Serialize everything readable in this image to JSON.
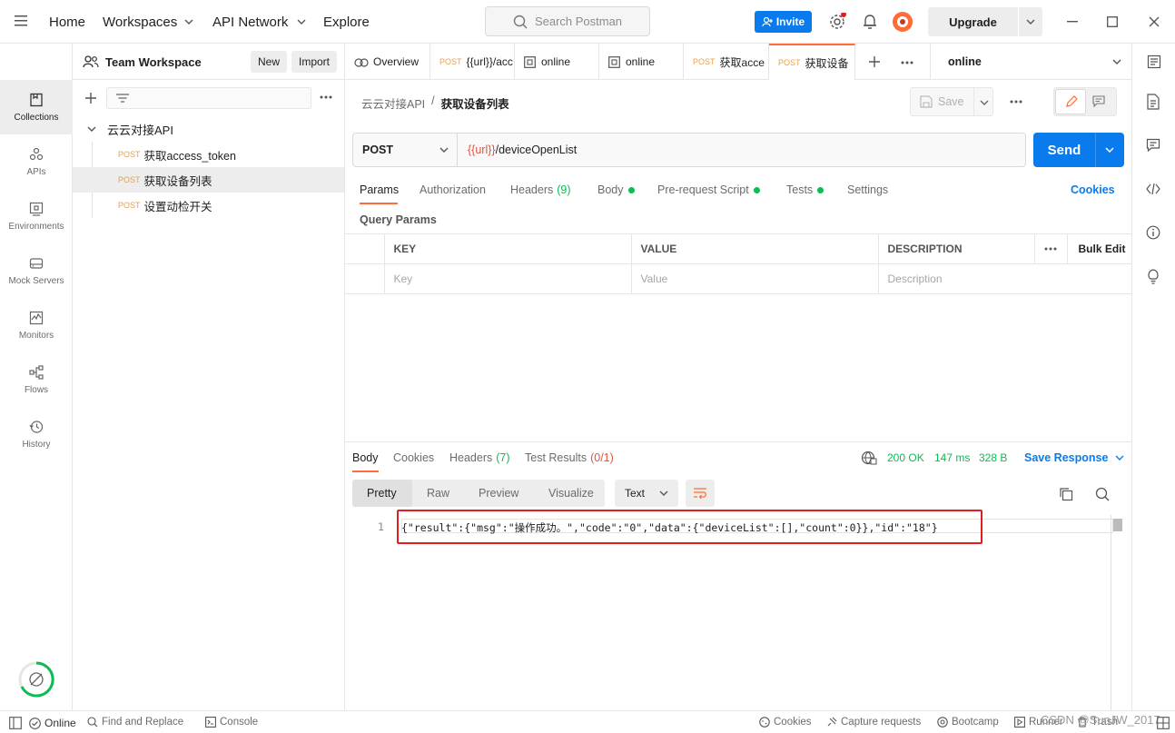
{
  "topbar": {
    "nav": [
      "Home",
      "Workspaces",
      "API Network",
      "Explore"
    ],
    "search_placeholder": "Search Postman",
    "invite_label": "Invite",
    "upgrade_label": "Upgrade"
  },
  "leftbar": {
    "items": [
      {
        "label": "Collections",
        "icon": "collections-icon"
      },
      {
        "label": "APIs",
        "icon": "apis-icon"
      },
      {
        "label": "Environments",
        "icon": "environments-icon"
      },
      {
        "label": "Mock Servers",
        "icon": "mock-servers-icon"
      },
      {
        "label": "Monitors",
        "icon": "monitors-icon"
      },
      {
        "label": "Flows",
        "icon": "flows-icon"
      },
      {
        "label": "History",
        "icon": "history-icon"
      }
    ]
  },
  "sidebar": {
    "workspace_name": "Team Workspace",
    "new_label": "New",
    "import_label": "Import",
    "collection_name": "云云对接API",
    "requests": [
      {
        "method": "POST",
        "name": "获取access_token"
      },
      {
        "method": "POST",
        "name": "获取设备列表"
      },
      {
        "method": "POST",
        "name": "设置动检开关"
      }
    ]
  },
  "tabs": [
    {
      "method": "",
      "label": "Overview"
    },
    {
      "method": "POST",
      "label": "{{url}}/acc"
    },
    {
      "method": "",
      "label": "online"
    },
    {
      "method": "",
      "label": "online"
    },
    {
      "method": "POST",
      "label": "获取acce"
    },
    {
      "method": "POST",
      "label": "获取设备"
    }
  ],
  "environment": "online",
  "request": {
    "breadcrumb_collection": "云云对接API",
    "breadcrumb_sep": "/",
    "breadcrumb_name": "获取设备列表",
    "save_label": "Save",
    "method": "POST",
    "url_var": "{{url}}",
    "url_path": "/deviceOpenList",
    "send_label": "Send",
    "tabs": {
      "params": "Params",
      "authorization": "Authorization",
      "headers": "Headers",
      "headers_count": "(9)",
      "body": "Body",
      "prerequest": "Pre-request Script",
      "tests": "Tests",
      "settings": "Settings"
    },
    "cookies_label": "Cookies",
    "query_params_title": "Query Params",
    "table": {
      "headers": [
        "KEY",
        "VALUE",
        "DESCRIPTION"
      ],
      "bulk_edit": "Bulk Edit",
      "placeholders": [
        "Key",
        "Value",
        "Description"
      ]
    }
  },
  "response": {
    "tabs": {
      "body": "Body",
      "cookies": "Cookies",
      "headers": "Headers",
      "headers_count": "(7)",
      "test_results": "Test Results",
      "test_count": "(0/1)"
    },
    "status": "200 OK",
    "time": "147 ms",
    "size": "328 B",
    "save_response": "Save Response",
    "views": [
      "Pretty",
      "Raw",
      "Preview",
      "Visualize"
    ],
    "format": "Text",
    "line_number": "1",
    "body": "{\"result\":{\"msg\":\"操作成功。\",\"code\":\"0\",\"data\":{\"deviceList\":[],\"count\":0}},\"id\":\"18\"}"
  },
  "statusbar": {
    "online": "Online",
    "find_replace": "Find and Replace",
    "console": "Console",
    "cookies": "Cookies",
    "capture": "Capture requests",
    "bootcamp": "Bootcamp",
    "runner": "Runner",
    "trash": "Trash",
    "watermark": "CSDN @SunJW_2017"
  },
  "colors": {
    "accent": "#097bed",
    "orange": "#ff6c37",
    "method_post": "#e8a14a",
    "ok_green": "#0cbb52",
    "highlight_red": "#e02020"
  }
}
